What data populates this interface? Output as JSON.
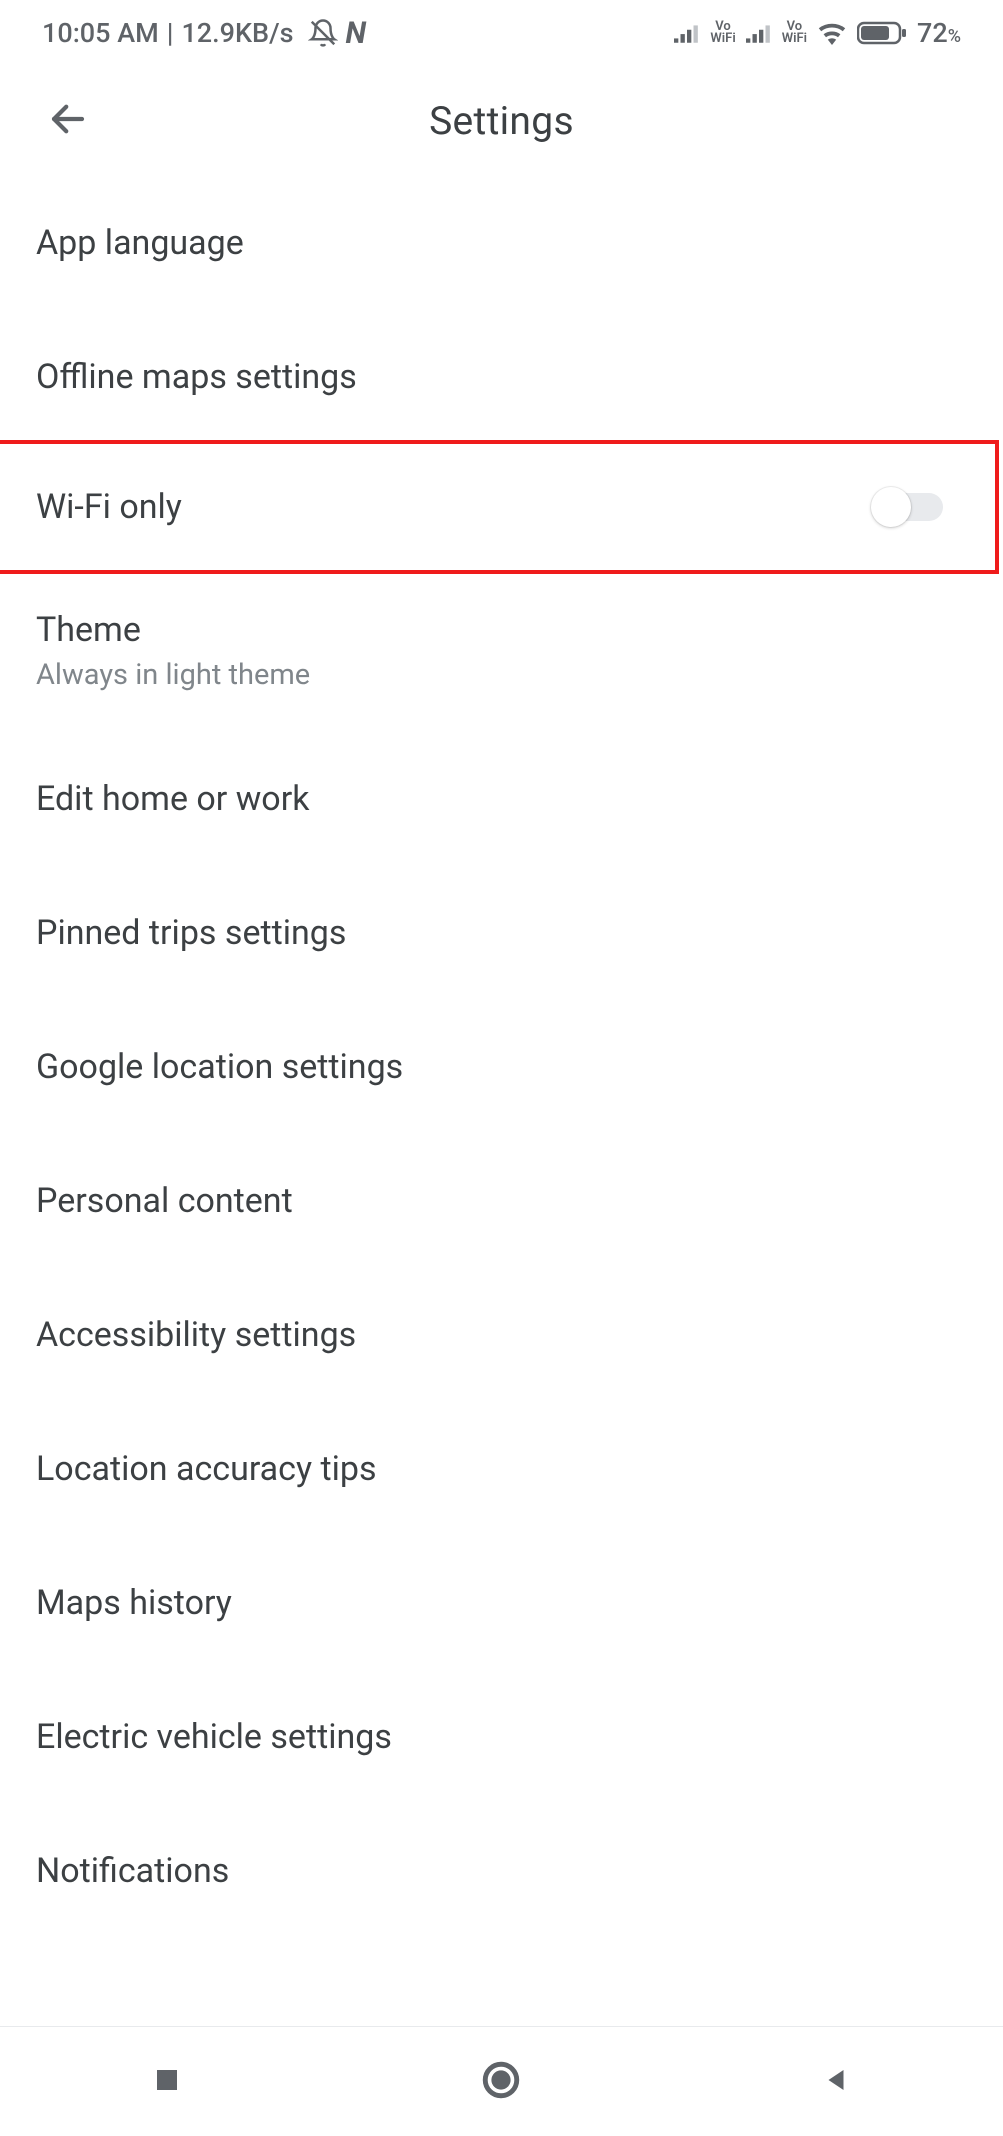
{
  "statusbar": {
    "time": "10:05 AM",
    "speed": "12.9KB/s",
    "battery_pct": "72",
    "battery_pct_suffix": "%"
  },
  "appbar": {
    "title": "Settings"
  },
  "rows": {
    "app_language": "App language",
    "offline_maps": "Offline maps settings",
    "wifi_only": "Wi-Fi only",
    "theme": {
      "label": "Theme",
      "sub": "Always in light theme"
    },
    "edit_home_work": "Edit home or work",
    "pinned_trips": "Pinned trips settings",
    "google_location": "Google location settings",
    "personal_content": "Personal content",
    "accessibility": "Accessibility settings",
    "location_tips": "Location accuracy tips",
    "maps_history": "Maps history",
    "ev_settings": "Electric vehicle settings",
    "notifications": "Notifications"
  },
  "toggle": {
    "wifi_only_on": false
  }
}
